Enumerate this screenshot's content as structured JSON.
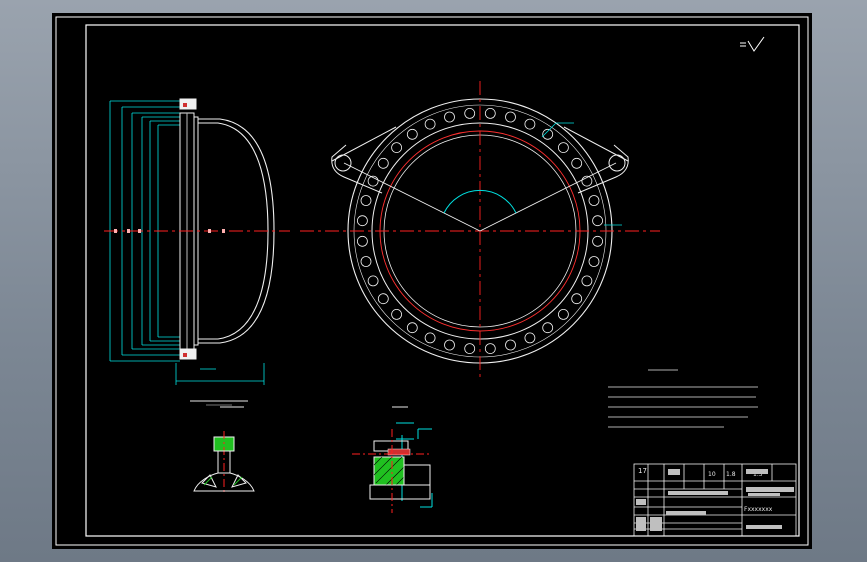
{
  "drawing": {
    "colors": {
      "frame": "#ffffff",
      "outline": "#f0f0f0",
      "centerline": "#ff2020",
      "dimension": "#00e0e0",
      "hidden": "#ff3030",
      "hatch": "#20c020",
      "marker": "#ffb0b0"
    },
    "tb_top": [
      "17",
      "10",
      "1.8",
      "1.5"
    ],
    "tb_right": [
      "Fxxxxxxx"
    ]
  }
}
